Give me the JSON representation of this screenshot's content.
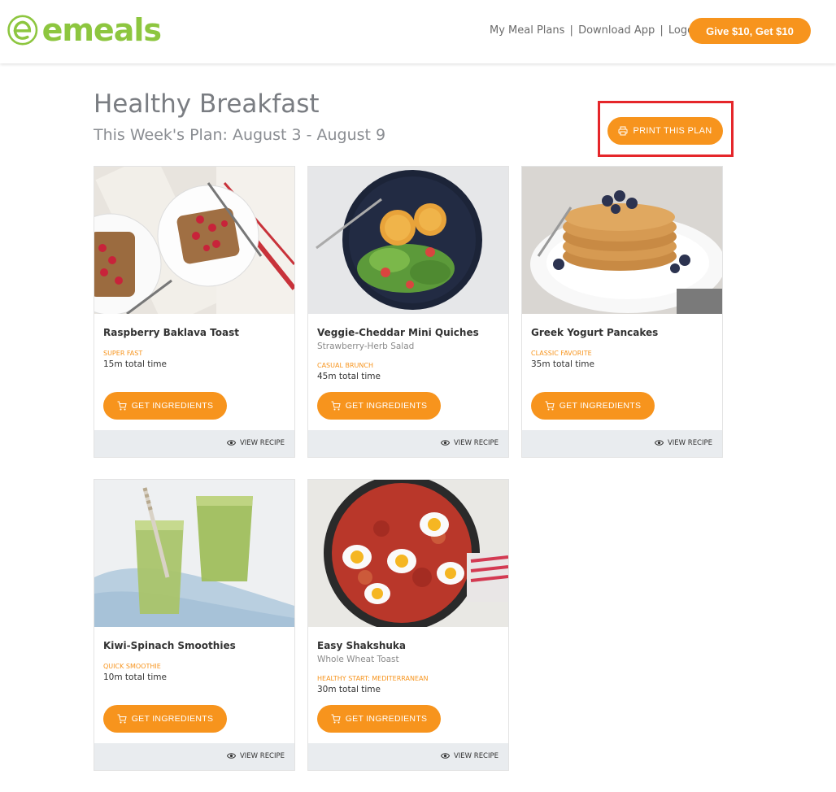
{
  "brand": {
    "logo_text": "emeals",
    "brand_green": "#8dc63f"
  },
  "header": {
    "nav": [
      {
        "label": "My Meal Plans",
        "icon": null
      },
      {
        "label": "Download App",
        "icon": null
      },
      {
        "label": "Logout",
        "icon": null
      }
    ],
    "separator": "|",
    "give_button": "Give $10, Get $10"
  },
  "plan": {
    "title": "Healthy Breakfast",
    "subtitle": "This Week's Plan: August 3 - August 9",
    "print_button": "PRINT THIS PLAN",
    "print_icon": "printer-icon"
  },
  "colors": {
    "accent": "#f7941d",
    "highlight_box": "#e5262a",
    "footer_bg": "#e9ecef"
  },
  "cards": [
    {
      "title": "Raspberry Baklava Toast",
      "side": "",
      "tag": "SUPER FAST",
      "time": "15m total time",
      "ingredients_label": "GET INGREDIENTS",
      "view_label": "VIEW RECIPE"
    },
    {
      "title": "Veggie-Cheddar Mini Quiches",
      "side": "Strawberry-Herb Salad",
      "tag": "CASUAL BRUNCH",
      "time": "45m total time",
      "ingredients_label": "GET INGREDIENTS",
      "view_label": "VIEW RECIPE"
    },
    {
      "title": "Greek Yogurt Pancakes",
      "side": "",
      "tag": "CLASSIC FAVORITE",
      "time": "35m total time",
      "ingredients_label": "GET INGREDIENTS",
      "view_label": "VIEW RECIPE"
    },
    {
      "title": "Kiwi-Spinach Smoothies",
      "side": "",
      "tag": "QUICK SMOOTHIE",
      "time": "10m total time",
      "ingredients_label": "GET INGREDIENTS",
      "view_label": "VIEW RECIPE"
    },
    {
      "title": "Easy Shakshuka",
      "side": "Whole Wheat Toast",
      "tag": "HEALTHY START: MEDITERRANEAN",
      "time": "30m total time",
      "ingredients_label": "GET INGREDIENTS",
      "view_label": "VIEW RECIPE"
    }
  ]
}
